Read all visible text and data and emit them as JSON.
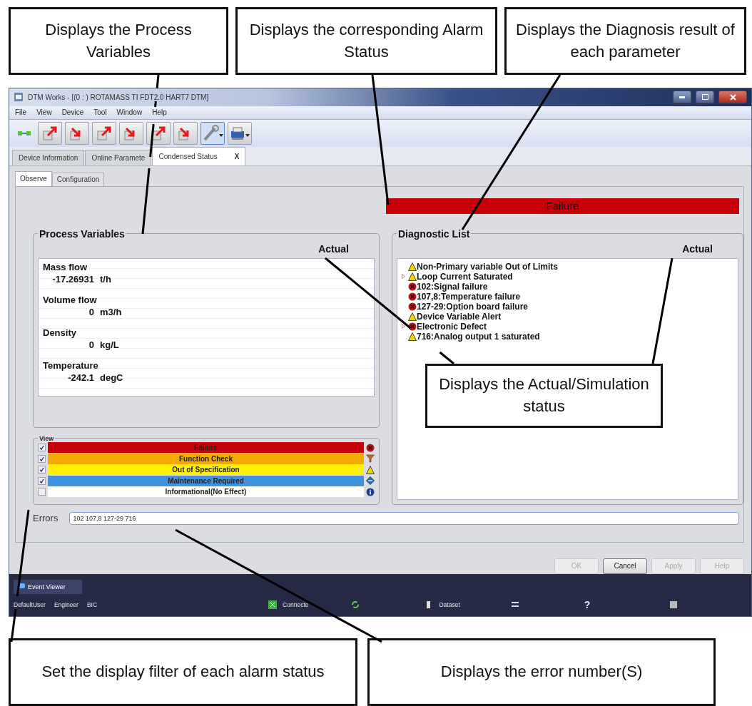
{
  "callouts_top": [
    "Displays the Process Variables",
    "Displays the corresponding Alarm Status",
    "Displays the Diagnosis result of each parameter"
  ],
  "callout_middle": "Displays the Actual/Simulation status",
  "callouts_bottom": [
    "Set the display filter of each alarm status",
    "Displays the error number(S)"
  ],
  "window": {
    "title": "DTM Works - [(0 : ) ROTAMASS TI FDT2.0 HART7 DTM]"
  },
  "menu": [
    "File",
    "View",
    "Device",
    "Tool",
    "Window",
    "Help"
  ],
  "doc_tabs": [
    {
      "label": "Device Information",
      "selected": false,
      "closable": false
    },
    {
      "label": "Online Paramete",
      "selected": false,
      "closable": false
    },
    {
      "label": "Condensed Status",
      "selected": true,
      "closable": true,
      "close": "X"
    }
  ],
  "sub_tabs": [
    {
      "label": "Observe",
      "selected": true
    },
    {
      "label": "Configuration",
      "selected": false
    }
  ],
  "status_bar_banner": {
    "label": "Failure",
    "color": "#c8000a"
  },
  "process_variables": {
    "title": "Process Variables",
    "column": "Actual",
    "items": [
      {
        "name": "Mass flow",
        "value": "-17.26931",
        "unit": "t/h"
      },
      {
        "name": "Volume flow",
        "value": "0",
        "unit": "m3/h"
      },
      {
        "name": "Density",
        "value": "0",
        "unit": "kg/L"
      },
      {
        "name": "Temperature",
        "value": "-242.1",
        "unit": "degC"
      }
    ]
  },
  "view": {
    "title": "View",
    "rows": [
      {
        "label": "Failure",
        "kind": "failure",
        "color": "#c8000a",
        "checked": true
      },
      {
        "label": "Function Check",
        "kind": "function_check",
        "color": "#f2a900",
        "checked": true
      },
      {
        "label": "Out of Specification",
        "kind": "out_of_spec",
        "color": "#fff200",
        "checked": true
      },
      {
        "label": "Maintenance Required",
        "kind": "maintenance",
        "color": "#3d93e0",
        "checked": true
      },
      {
        "label": "Informational(No Effect)",
        "kind": "info",
        "color": "#ffffff",
        "checked": false
      }
    ]
  },
  "diagnostic_list": {
    "title": "Diagnostic List",
    "column": "Actual",
    "items": [
      {
        "label": "Non-Primary variable Out of Limits",
        "kind": "warning",
        "collapsible": false
      },
      {
        "label": "Loop Current Saturated",
        "kind": "warning",
        "collapsible": true
      },
      {
        "label": "102:Signal failure",
        "kind": "error",
        "collapsible": false
      },
      {
        "label": "107,8:Temperature failure",
        "kind": "error",
        "collapsible": false
      },
      {
        "label": "127-29:Option board failure",
        "kind": "error",
        "collapsible": false
      },
      {
        "label": "Device Variable Alert",
        "kind": "warning",
        "collapsible": false
      },
      {
        "label": "Electronic Defect",
        "kind": "error",
        "collapsible": true
      },
      {
        "label": "716:Analog output 1 saturated",
        "kind": "warning",
        "collapsible": false
      }
    ]
  },
  "errors": {
    "label": "Errors",
    "value": "102 107,8 127-29 716"
  },
  "buttons": [
    {
      "label": "OK",
      "disabled": true
    },
    {
      "label": "Cancel",
      "disabled": false
    },
    {
      "label": "Apply",
      "disabled": true
    },
    {
      "label": "Help",
      "disabled": true
    }
  ],
  "event_viewer": {
    "tab": "Event Viewer"
  },
  "status_bar": {
    "user": "DefaultUser",
    "role": "Engineer",
    "site": "BIC",
    "connection": "Connecte",
    "dataset": "Dataset",
    "help": "?"
  }
}
